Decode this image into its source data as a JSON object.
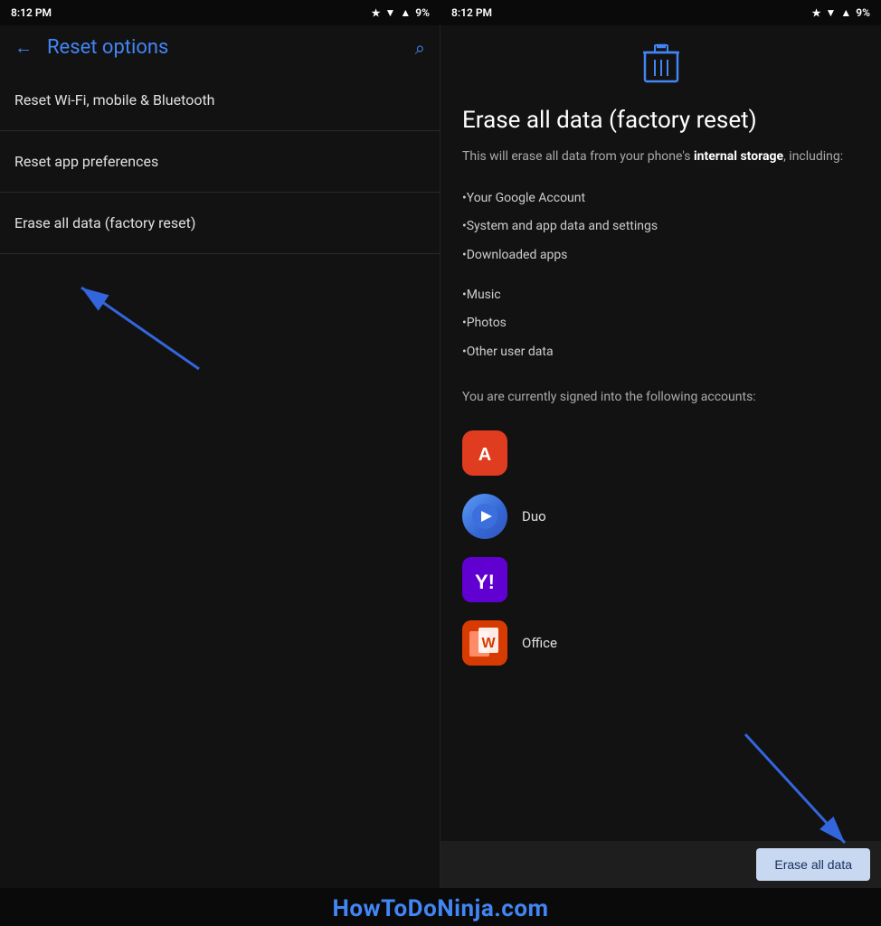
{
  "left": {
    "statusBar": {
      "time": "8:12 PM",
      "battery": "9%"
    },
    "toolbar": {
      "backLabel": "←",
      "title": "Reset options",
      "searchIcon": "🔍"
    },
    "menuItems": [
      {
        "id": "wifi-reset",
        "label": "Reset Wi-Fi, mobile & Bluetooth"
      },
      {
        "id": "app-prefs",
        "label": "Reset app preferences"
      },
      {
        "id": "factory-reset",
        "label": "Erase all data (factory reset)"
      }
    ]
  },
  "right": {
    "statusBar": {
      "time": "8:12 PM",
      "battery": "9%"
    },
    "trashIcon": "🗑",
    "title": "Erase all data (factory reset)",
    "description": "This will erase all data from your phone's internal storage, including:",
    "dataItems": [
      "•Your Google Account",
      "•System and app data and settings",
      "•Downloaded apps",
      "•Music",
      "•Photos",
      "•Other user data"
    ],
    "accountsLabel": "You are currently signed into the following accounts:",
    "accounts": [
      {
        "id": "adobe",
        "name": "",
        "icon": "A",
        "bgColor": "#e03c20"
      },
      {
        "id": "duo",
        "name": "Duo",
        "icon": "▶",
        "bgColor": "#3c6fdd"
      },
      {
        "id": "yahoo",
        "name": "",
        "icon": "Y!",
        "bgColor": "#6001d2"
      },
      {
        "id": "office",
        "name": "Office",
        "icon": "W",
        "bgColor": "#d83b01"
      }
    ],
    "eraseButtonLabel": "Erase all data"
  },
  "watermark": "HowToDoNinja.com"
}
